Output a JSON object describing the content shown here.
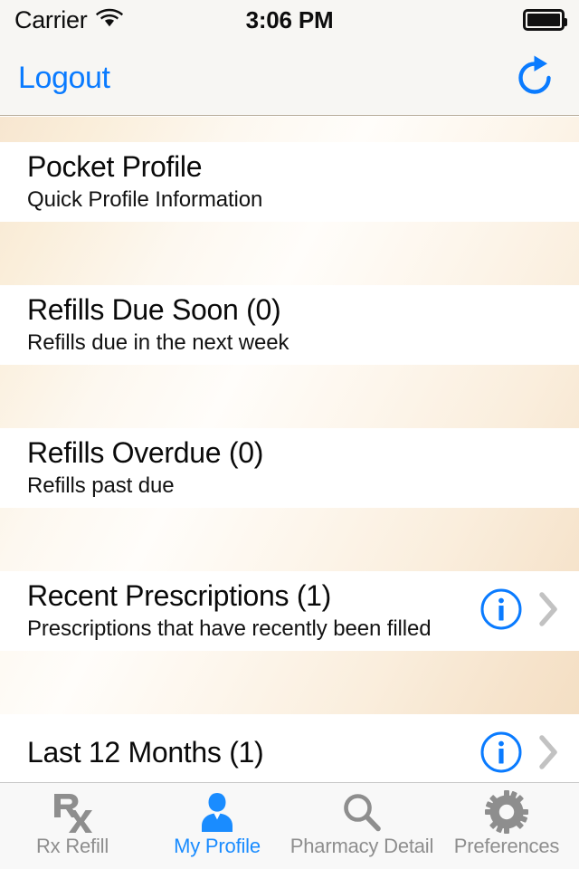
{
  "status_bar": {
    "carrier": "Carrier",
    "wifi_icon": "wifi-icon",
    "time": "3:06 PM",
    "battery_icon": "battery-full-icon"
  },
  "nav_bar": {
    "logout_label": "Logout",
    "refresh_icon": "refresh-icon",
    "accent_color": "#0a7bff"
  },
  "list": {
    "rows": [
      {
        "title": "Pocket Profile",
        "subtitle": "Quick Profile Information",
        "has_info": false,
        "has_chevron": false
      },
      {
        "title": "Refills Due Soon (0)",
        "subtitle": "Refills due in the next week",
        "has_info": false,
        "has_chevron": false
      },
      {
        "title": "Refills Overdue (0)",
        "subtitle": "Refills past due",
        "has_info": false,
        "has_chevron": false
      },
      {
        "title": "Recent Prescriptions (1)",
        "subtitle": "Prescriptions that have recently been filled",
        "has_info": true,
        "has_chevron": true
      },
      {
        "title": "Last 12 Months (1)",
        "subtitle": "",
        "has_info": true,
        "has_chevron": true
      }
    ]
  },
  "tab_bar": {
    "active_color": "#1a8cff",
    "inactive_color": "#8e8e8e",
    "tabs": [
      {
        "label": "Rx Refill",
        "icon": "rx-icon",
        "active": false
      },
      {
        "label": "My Profile",
        "icon": "person-icon",
        "active": true
      },
      {
        "label": "Pharmacy Detail",
        "icon": "search-icon",
        "active": false
      },
      {
        "label": "Preferences",
        "icon": "gear-icon",
        "active": false
      }
    ]
  }
}
